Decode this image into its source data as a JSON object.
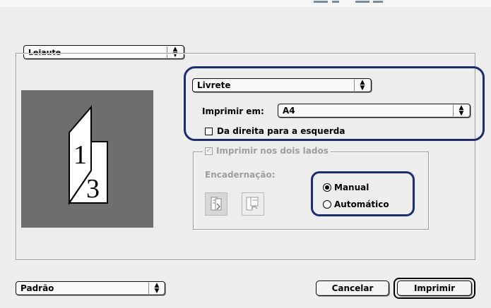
{
  "panel_menu": {
    "selected": "Leiaute"
  },
  "layout_menu": {
    "selected": "Livrete"
  },
  "print_on": {
    "label": "Imprimir em:",
    "selected": "A4"
  },
  "right_to_left": {
    "label": "Da direita para a esquerda",
    "checked": false
  },
  "two_sided": {
    "label": "Imprimir nos dois lados",
    "checked": true,
    "enabled": false,
    "binding_label": "Encadernação:",
    "options": [
      {
        "label": "Manual",
        "selected": true
      },
      {
        "label": "Automático",
        "selected": false
      }
    ]
  },
  "preview": {
    "page_top": "1",
    "page_bottom": "3"
  },
  "preset_menu": {
    "selected": "Padrão"
  },
  "buttons": {
    "cancel": "Cancelar",
    "print": "Imprimir"
  },
  "colors": {
    "highlight": "#1b2c70",
    "preview_bg": "#6e6e6e"
  }
}
